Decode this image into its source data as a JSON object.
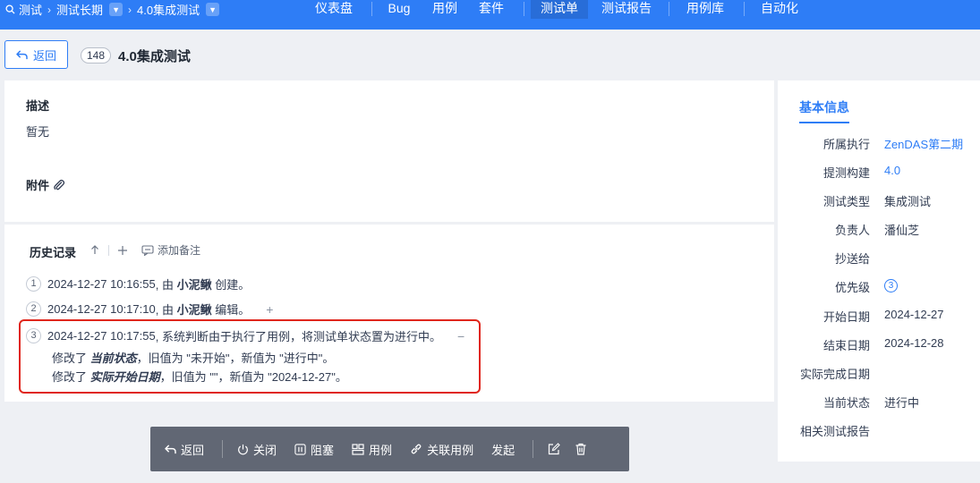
{
  "nav": {
    "breadcrumbs": [
      "测试",
      "测试长期",
      "4.0集成测试"
    ],
    "items": [
      "仪表盘",
      "Bug",
      "用例",
      "套件",
      "测试单",
      "测试报告",
      "用例库",
      "自动化"
    ],
    "active": "测试单"
  },
  "header": {
    "back_label": "返回",
    "id": "148",
    "title": "4.0集成测试"
  },
  "description": {
    "title": "描述",
    "content": "暂无",
    "attachments_label": "附件"
  },
  "history": {
    "title": "历史记录",
    "add_note": "添加备注",
    "entries": [
      {
        "num": "1",
        "time": "2024-12-27 10:16:55",
        "pre": ", 由 ",
        "user": "小泥鳅",
        "action": " 创建。"
      },
      {
        "num": "2",
        "time": "2024-12-27 10:17:10",
        "pre": ", 由 ",
        "user": "小泥鳅",
        "action": " 编辑。"
      },
      {
        "num": "3",
        "time": "2024-12-27 10:17:55",
        "text": ", 系统判断由于执行了用例，将测试单状态置为进行中。",
        "changes": [
          {
            "pre": "修改了 ",
            "field": "当前状态",
            "rest": "，旧值为 \"未开始\"，新值为 \"进行中\"。"
          },
          {
            "pre": "修改了 ",
            "field": "实际开始日期",
            "rest": "，旧值为 \"\"，新值为 \"2024-12-27\"。"
          }
        ]
      }
    ]
  },
  "info": {
    "title": "基本信息",
    "rows": [
      {
        "label": "所属执行",
        "value": "ZenDAS第二期"
      },
      {
        "label": "提测构建",
        "value": "4.0"
      },
      {
        "label": "测试类型",
        "value": "集成测试"
      },
      {
        "label": "负责人",
        "value": "潘仙芝"
      },
      {
        "label": "抄送给",
        "value": ""
      },
      {
        "label": "优先级",
        "value": "3"
      },
      {
        "label": "开始日期",
        "value": "2024-12-27"
      },
      {
        "label": "结束日期",
        "value": "2024-12-28"
      },
      {
        "label": "实际完成日期",
        "value": ""
      },
      {
        "label": "当前状态",
        "value": "进行中"
      },
      {
        "label": "相关测试报告",
        "value": ""
      }
    ]
  },
  "toolbar": {
    "back": "返回",
    "close": "关闭",
    "block": "阻塞",
    "cases": "用例",
    "link_cases": "关联用例",
    "launch": "发起"
  },
  "colors": {
    "primary": "#2e7df6",
    "highlight": "#e0261c",
    "toolbar": "#616774"
  }
}
